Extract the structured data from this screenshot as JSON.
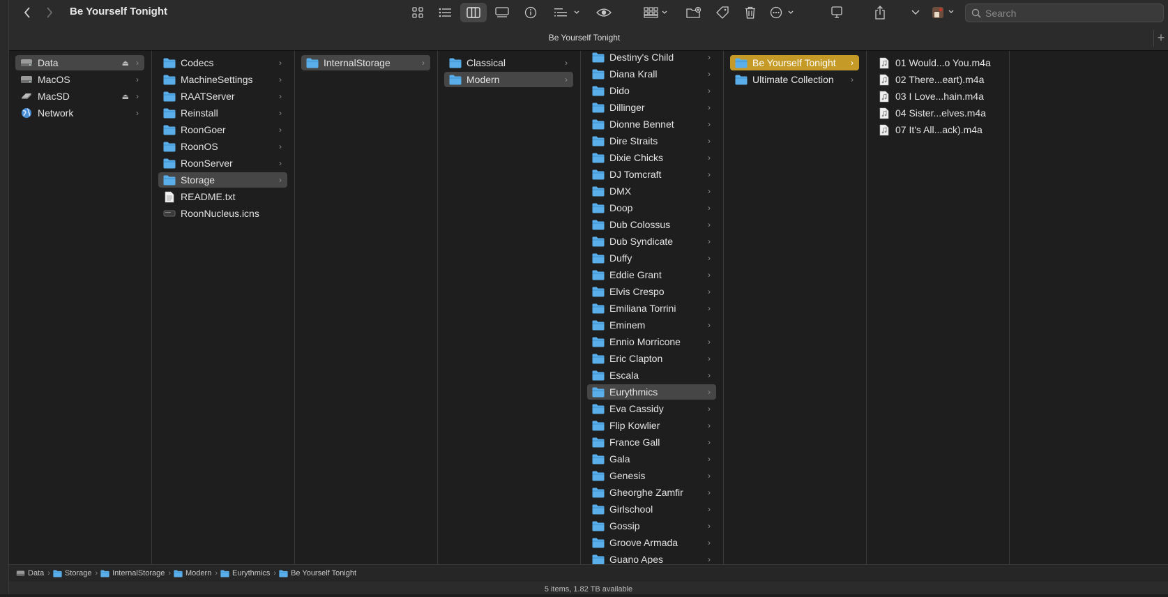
{
  "window": {
    "title": "Be Yourself Tonight",
    "tab_title": "Be Yourself Tonight"
  },
  "search": {
    "placeholder": "Search"
  },
  "colors": {
    "folder": "#5aaee9",
    "selection": "#464646",
    "selection_active": "#c59a26"
  },
  "columns": [
    {
      "items": [
        {
          "label": "Data",
          "icon": "drive-icon",
          "eject": true,
          "selected": true
        },
        {
          "label": "MacOS",
          "icon": "drive-icon"
        },
        {
          "label": "MacSD",
          "icon": "sd-card-icon",
          "eject": true
        },
        {
          "label": "Network",
          "icon": "globe-icon"
        }
      ]
    },
    {
      "items": [
        {
          "label": "Codecs",
          "icon": "folder-icon",
          "chevron": true
        },
        {
          "label": "MachineSettings",
          "icon": "folder-icon",
          "chevron": true
        },
        {
          "label": "RAATServer",
          "icon": "folder-icon",
          "chevron": true
        },
        {
          "label": "Reinstall",
          "icon": "folder-icon",
          "chevron": true
        },
        {
          "label": "RoonGoer",
          "icon": "folder-icon",
          "chevron": true
        },
        {
          "label": "RoonOS",
          "icon": "folder-icon",
          "chevron": true
        },
        {
          "label": "RoonServer",
          "icon": "folder-icon",
          "chevron": true
        },
        {
          "label": "Storage",
          "icon": "folder-icon",
          "chevron": true,
          "selected": true
        },
        {
          "label": "README.txt",
          "icon": "text-file-icon"
        },
        {
          "label": "RoonNucleus.icns",
          "icon": "icns-file-icon"
        }
      ]
    },
    {
      "items": [
        {
          "label": "InternalStorage",
          "icon": "folder-icon",
          "chevron": true,
          "selected": true
        }
      ]
    },
    {
      "items": [
        {
          "label": "Classical",
          "icon": "folder-icon",
          "chevron": true
        },
        {
          "label": "Modern",
          "icon": "folder-icon",
          "chevron": true,
          "selected": true
        }
      ]
    },
    {
      "items": [
        {
          "label": "Destiny's Child",
          "icon": "folder-icon",
          "chevron": true
        },
        {
          "label": "Diana Krall",
          "icon": "folder-icon",
          "chevron": true
        },
        {
          "label": "Dido",
          "icon": "folder-icon",
          "chevron": true
        },
        {
          "label": "Dillinger",
          "icon": "folder-icon",
          "chevron": true
        },
        {
          "label": "Dionne Bennet",
          "icon": "folder-icon",
          "chevron": true
        },
        {
          "label": "Dire Straits",
          "icon": "folder-icon",
          "chevron": true
        },
        {
          "label": "Dixie Chicks",
          "icon": "folder-icon",
          "chevron": true
        },
        {
          "label": "DJ Tomcraft",
          "icon": "folder-icon",
          "chevron": true
        },
        {
          "label": "DMX",
          "icon": "folder-icon",
          "chevron": true
        },
        {
          "label": "Doop",
          "icon": "folder-icon",
          "chevron": true
        },
        {
          "label": "Dub Colossus",
          "icon": "folder-icon",
          "chevron": true
        },
        {
          "label": "Dub Syndicate",
          "icon": "folder-icon",
          "chevron": true
        },
        {
          "label": "Duffy",
          "icon": "folder-icon",
          "chevron": true
        },
        {
          "label": "Eddie Grant",
          "icon": "folder-icon",
          "chevron": true
        },
        {
          "label": "Elvis Crespo",
          "icon": "folder-icon",
          "chevron": true
        },
        {
          "label": "Emiliana Torrini",
          "icon": "folder-icon",
          "chevron": true
        },
        {
          "label": "Eminem",
          "icon": "folder-icon",
          "chevron": true
        },
        {
          "label": "Ennio Morricone",
          "icon": "folder-icon",
          "chevron": true
        },
        {
          "label": "Eric Clapton",
          "icon": "folder-icon",
          "chevron": true
        },
        {
          "label": "Escala",
          "icon": "folder-icon",
          "chevron": true
        },
        {
          "label": "Eurythmics",
          "icon": "folder-icon",
          "chevron": true,
          "selected": true
        },
        {
          "label": "Eva Cassidy",
          "icon": "folder-icon",
          "chevron": true
        },
        {
          "label": "Flip Kowlier",
          "icon": "folder-icon",
          "chevron": true
        },
        {
          "label": "France Gall",
          "icon": "folder-icon",
          "chevron": true
        },
        {
          "label": "Gala",
          "icon": "folder-icon",
          "chevron": true
        },
        {
          "label": "Genesis",
          "icon": "folder-icon",
          "chevron": true
        },
        {
          "label": "Gheorghe Zamfir",
          "icon": "folder-icon",
          "chevron": true
        },
        {
          "label": "Girlschool",
          "icon": "folder-icon",
          "chevron": true
        },
        {
          "label": "Gossip",
          "icon": "folder-icon",
          "chevron": true
        },
        {
          "label": "Groove Armada",
          "icon": "folder-icon",
          "chevron": true
        },
        {
          "label": "Guano Apes",
          "icon": "folder-icon",
          "chevron": true
        }
      ]
    },
    {
      "items": [
        {
          "label": "Be Yourself Tonight",
          "icon": "folder-icon",
          "chevron": true,
          "active": true
        },
        {
          "label": "Ultimate Collection",
          "icon": "folder-icon",
          "chevron": true
        }
      ]
    },
    {
      "items": [
        {
          "label": "01 Would...o You.m4a",
          "icon": "audio-file-icon"
        },
        {
          "label": "02 There...eart).m4a",
          "icon": "audio-file-icon"
        },
        {
          "label": "03 I Love...hain.m4a",
          "icon": "audio-file-icon"
        },
        {
          "label": "04 Sister...elves.m4a",
          "icon": "audio-file-icon"
        },
        {
          "label": "07 It's All...ack).m4a",
          "icon": "audio-file-icon"
        }
      ]
    }
  ],
  "path": [
    "Data",
    "Storage",
    "InternalStorage",
    "Modern",
    "Eurythmics",
    "Be Yourself Tonight"
  ],
  "status": "5 items, 1.82 TB available"
}
